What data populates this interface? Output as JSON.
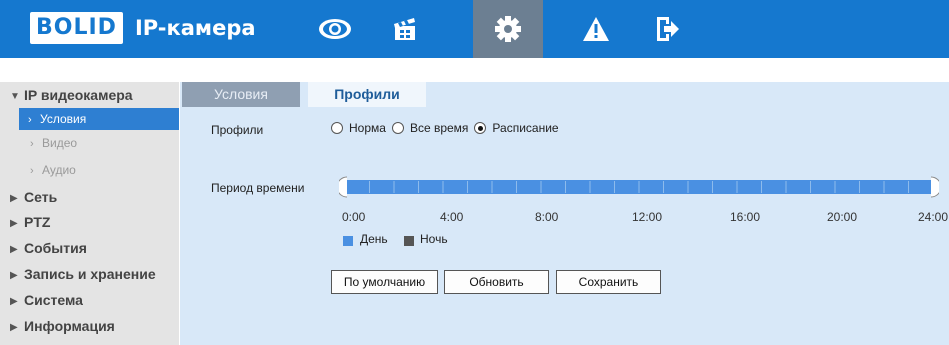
{
  "header": {
    "logo_text": "BOLID",
    "title": "IP-камера",
    "nav": [
      {
        "icon": "eye-icon"
      },
      {
        "icon": "clapperboard-icon"
      },
      {
        "icon": "gear-icon",
        "active": true
      },
      {
        "icon": "warning-icon"
      },
      {
        "icon": "exit-icon"
      }
    ]
  },
  "sidebar": {
    "items": [
      {
        "label": "IP видеокамера",
        "expanded": true
      },
      {
        "label": "Условия",
        "selected": true
      },
      {
        "label": "Видео"
      },
      {
        "label": "Аудио"
      },
      {
        "label": "Сеть"
      },
      {
        "label": "PTZ"
      },
      {
        "label": "События"
      },
      {
        "label": "Запись и хранение"
      },
      {
        "label": "Система"
      },
      {
        "label": "Информация"
      }
    ]
  },
  "tabs": [
    {
      "label": "Условия"
    },
    {
      "label": "Профили",
      "active": true
    }
  ],
  "form": {
    "profiles_label": "Профили",
    "radio_options": [
      {
        "label": "Норма",
        "checked": false
      },
      {
        "label": "Все время",
        "checked": false
      },
      {
        "label": "Расписание",
        "checked": true
      }
    ],
    "time_period_label": "Период времени",
    "timeline_ticks": [
      "0:00",
      "4:00",
      "8:00",
      "12:00",
      "16:00",
      "20:00",
      "24:00"
    ],
    "legend": [
      {
        "label": "День",
        "color": "#4a90e2"
      },
      {
        "label": "Ночь",
        "color": "#555555"
      }
    ]
  },
  "buttons": {
    "default_label": "По умолчанию",
    "refresh_label": "Обновить",
    "save_label": "Сохранить"
  },
  "colors": {
    "header_blue": "#1578cf",
    "active_nav": "#6c7f92",
    "content_bg": "#d8e8f8",
    "selected_item": "#2e7fd2"
  }
}
